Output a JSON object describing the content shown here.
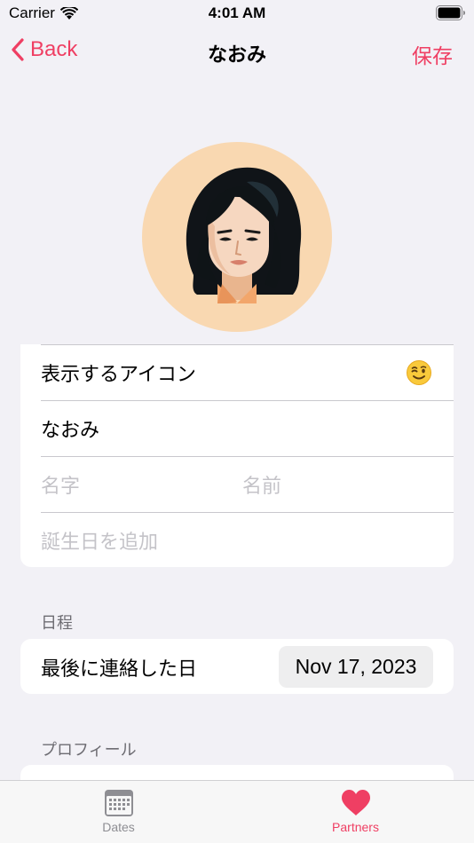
{
  "status": {
    "carrier": "Carrier",
    "time": "4:01 AM"
  },
  "nav": {
    "back_label": "Back",
    "title": "なおみ",
    "save_label": "保存"
  },
  "form": {
    "icon_row_label": "表示するアイコン",
    "icon_emoji_name": "winking-face-icon",
    "nickname": "なおみ",
    "last_name_placeholder": "名字",
    "first_name_placeholder": "名前",
    "birthday_placeholder": "誕生日を追加"
  },
  "schedule": {
    "section_label": "日程",
    "last_contact_label": "最後に連絡した日",
    "last_contact_date": "Nov 17, 2023"
  },
  "profile": {
    "section_label": "プロフィール"
  },
  "tabbar": {
    "tabs": [
      {
        "label": "Dates",
        "icon": "calendar-icon",
        "active": false
      },
      {
        "label": "Partners",
        "icon": "heart-icon",
        "active": true
      }
    ]
  },
  "colors": {
    "accent": "#ef3f63",
    "background": "#f2f1f6",
    "avatar_bg": "#f9d8b1"
  }
}
